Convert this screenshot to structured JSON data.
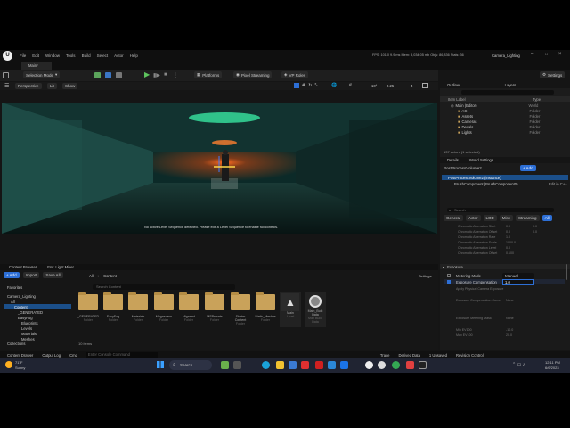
{
  "titlebar": {
    "project": "Camera_Lighting",
    "menus": [
      "File",
      "Edit",
      "Window",
      "Tools",
      "Build",
      "Select",
      "Actor",
      "Help"
    ],
    "stats": "FPS: 101.0  9.9 ms  Mem: 3,034.05 mb  Objs: 86,836  Stats: 36"
  },
  "tabs": {
    "map_tab": "Main*"
  },
  "toolbar": {
    "selection_mode": "Selection Mode",
    "platforms": "Platforms",
    "pixel_streaming": "Pixel Streaming",
    "vp_roles": "VP Roles",
    "settings": "Settings"
  },
  "viewport": {
    "perspective": "Perspective",
    "lit": "Lit",
    "show": "Show",
    "angle": "10°",
    "scale": "0.25",
    "cam_speed": "4",
    "message": "No active Level Sequence detected. Please edit a Level Sequence to enable full controls."
  },
  "outliner": {
    "title": "Outliner",
    "tab2": "Layers",
    "col_label": "Item Label",
    "col_type": "Type",
    "items": [
      {
        "label": "Main (Editor)",
        "type": "World"
      },
      {
        "label": "AC",
        "type": "Folder"
      },
      {
        "label": "Assets",
        "type": "Folder"
      },
      {
        "label": "Cameras",
        "type": "Folder"
      },
      {
        "label": "Decals",
        "type": "Folder"
      },
      {
        "label": "Lights",
        "type": "Folder"
      }
    ],
    "count": "137 actors (1 selected)"
  },
  "details": {
    "title": "Details",
    "tab2": "World Settings",
    "object": "PostProcessVolume2",
    "add": "+ Add",
    "instance": "PostProcessVolume2 (Instance)",
    "component": "BrushComponent (BrushComponent0)",
    "edit_cpp": "Edit in C++",
    "search_placeholder": "Search",
    "filters": [
      "General",
      "Actor",
      "LOD",
      "Misc",
      "Streaming",
      "All"
    ],
    "props_top": [
      {
        "label": "Chromatic Aberration Start",
        "v1": "0.0",
        "v2": "0.0"
      },
      {
        "label": "Chromatic Aberration Offset",
        "v1": "0.0",
        "v2": "0.0"
      },
      {
        "label": "Chromatic Aberration Rate",
        "v1": "1.0",
        "v2": ""
      },
      {
        "label": "Chromatic Aberration Scale",
        "v1": "1000.0",
        "v2": ""
      },
      {
        "label": "Chromatic Aberration Level",
        "v1": "0.0",
        "v2": ""
      },
      {
        "label": "Chromatic Aberration Offset",
        "v1": "0.100",
        "v2": ""
      }
    ],
    "section": "Exposure",
    "metering_label": "Metering Mode",
    "metering_value": "Manual",
    "exposure_label": "Exposure Compensation",
    "exposure_value": "1.0",
    "props_bottom": [
      {
        "label": "Apply Physical Camera Exposure",
        "v1": ""
      },
      {
        "label": "Exposure Compensation Curve",
        "v1": "None"
      },
      {
        "label": "Exposure Metering Mask",
        "v1": "None"
      },
      {
        "label": "Min EV100",
        "v1": "-10.0"
      },
      {
        "label": "Max EV100",
        "v1": "20.0"
      }
    ]
  },
  "content_browser": {
    "tab1": "Content Browser",
    "tab2": "Env. Light Mixer",
    "add": "+ Add",
    "import": "Import",
    "save_all": "Save All",
    "path": [
      "All",
      "Content"
    ],
    "settings": "Settings",
    "search_placeholder": "Search Content",
    "favorites": "Favorites",
    "project": "Camera_Lighting",
    "tree": [
      "All",
      "Content",
      "_GENERATED",
      "EasyFog",
      "Blueprints",
      "Levels",
      "Materials",
      "Meshes"
    ],
    "collections": "Collections",
    "assets": [
      {
        "name": "_GENERATED",
        "type": "Folder"
      },
      {
        "name": "EasyFog",
        "type": "Folder"
      },
      {
        "name": "Materials",
        "type": "Folder"
      },
      {
        "name": "Megascans",
        "type": "Folder"
      },
      {
        "name": "Migrated",
        "type": "Folder"
      },
      {
        "name": "MSPresets",
        "type": "Folder"
      },
      {
        "name": "Starter Content",
        "type": "Folder"
      },
      {
        "name": "Static_Meshes",
        "type": "Folder"
      },
      {
        "name": "Main",
        "type": "Level"
      },
      {
        "name": "Main_Built Data",
        "type": "Map Build Data"
      }
    ],
    "count": "10 items"
  },
  "statusbar": {
    "content_drawer": "Content Drawer",
    "output_log": "Output Log",
    "cmd": "Cmd",
    "cmd_placeholder": "Enter Console Command",
    "trace": "Trace",
    "derived_data": "Derived Data",
    "unsaved": "1 Unsaved",
    "revision": "Revision Control"
  },
  "taskbar": {
    "temp": "71°F",
    "weather": "Sunny",
    "search": "Search",
    "time": "12:11 PM",
    "date": "6/6/2023"
  },
  "colors": {
    "accent": "#2d6fd6",
    "selection": "#1b4f8a",
    "folder": "#c9a25a"
  }
}
